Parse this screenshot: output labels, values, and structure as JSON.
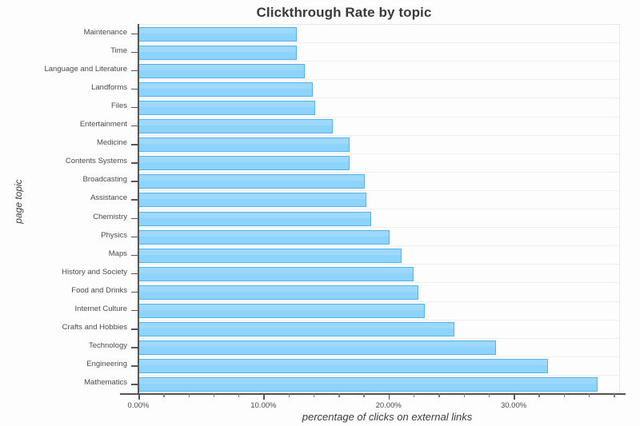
{
  "chart_data": {
    "type": "bar",
    "orientation": "horizontal",
    "title": "Clickthrough Rate by topic",
    "xlabel": "percentage of clicks on external links",
    "ylabel": "page topic",
    "xlim": [
      0,
      38.5
    ],
    "xtick_labels": [
      "0.00%",
      "10.00%",
      "20.00%",
      "30.00%"
    ],
    "xtick_values": [
      0,
      10,
      20,
      30
    ],
    "xtick_minor_step": 2,
    "grid": "horizontal",
    "legend": null,
    "bar_color": "#8ed3fb",
    "bar_border_color": "#4eb5f0",
    "categories": [
      "Maintenance",
      "Time",
      "Language and Literature",
      "Landforms",
      "Files",
      "Entertainment",
      "Medicine",
      "Contents Systems",
      "Broadcasting",
      "Assistance",
      "Chemistry",
      "Physics",
      "Maps",
      "History and Society",
      "Food and Drinks",
      "Internet Culture",
      "Crafts and Hobbies",
      "Technology",
      "Engineering",
      "Mathematics"
    ],
    "values": [
      12.67,
      12.67,
      13.31,
      13.95,
      14.14,
      15.55,
      16.89,
      16.89,
      18.11,
      18.23,
      18.62,
      20.09,
      21.05,
      22.01,
      22.39,
      22.9,
      25.27,
      28.6,
      32.76,
      36.72
    ]
  }
}
